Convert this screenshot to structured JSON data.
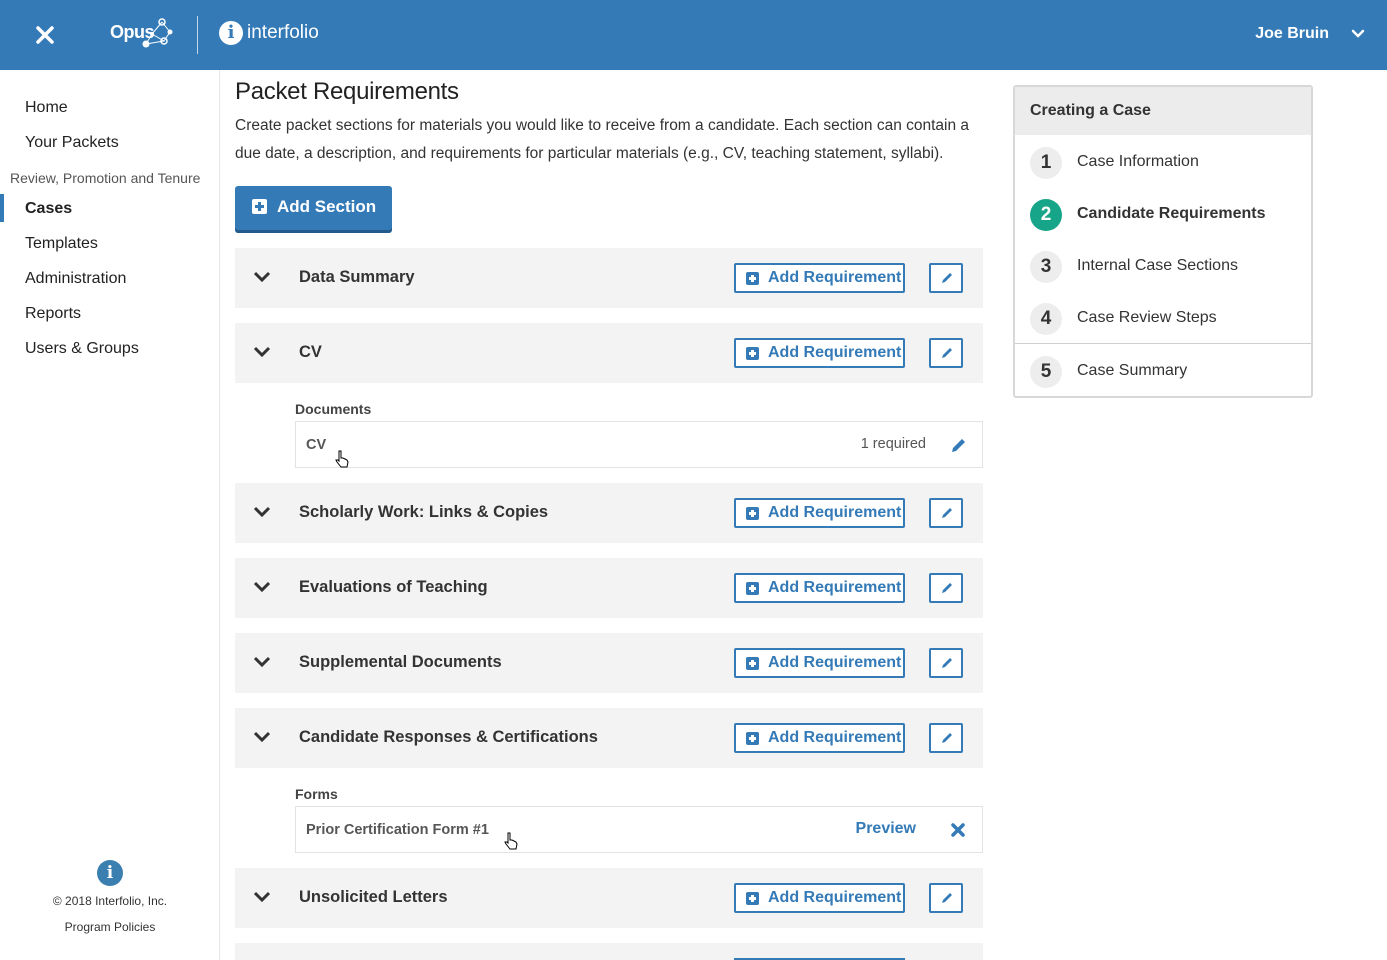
{
  "header": {
    "opus_label": "Opus",
    "interfolio_label": "interfolio",
    "user_name": "Joe Bruin"
  },
  "sidebar": {
    "items": [
      {
        "label": "Home"
      },
      {
        "label": "Your Packets"
      }
    ],
    "section_label": "Review, Promotion and Tenure",
    "section_items": [
      {
        "label": "Cases",
        "active": true
      },
      {
        "label": "Templates"
      },
      {
        "label": "Administration"
      },
      {
        "label": "Reports"
      },
      {
        "label": "Users & Groups"
      }
    ],
    "copyright": "© 2018 Interfolio, Inc.",
    "policies": "Program Policies"
  },
  "main": {
    "title": "Packet Requirements",
    "description": "Create packet sections for materials you would like to receive from a candidate. Each section can contain a due date, a description, and requirements for particular materials (e.g., CV, teaching statement, syllabi).",
    "add_section_label": "Add Section",
    "add_requirement_label": "Add Requirement",
    "sections": [
      {
        "title": "Data Summary"
      },
      {
        "title": "CV"
      },
      {
        "title": "Scholarly Work: Links & Copies"
      },
      {
        "title": "Evaluations of Teaching"
      },
      {
        "title": "Supplemental Documents"
      },
      {
        "title": "Candidate Responses & Certifications"
      },
      {
        "title": "Unsolicited Letters"
      }
    ],
    "cv_documents": {
      "label": "Documents",
      "item_name": "CV",
      "item_required": "1 required"
    },
    "cert_forms": {
      "label": "Forms",
      "item_name": "Prior Certification Form #1",
      "preview_label": "Preview"
    }
  },
  "panel": {
    "title": "Creating a Case",
    "steps": [
      {
        "number": "1",
        "label": "Case Information"
      },
      {
        "number": "2",
        "label": "Candidate Requirements",
        "active": true
      },
      {
        "number": "3",
        "label": "Internal Case Sections"
      },
      {
        "number": "4",
        "label": "Case Review Steps"
      },
      {
        "number": "5",
        "label": "Case Summary"
      }
    ]
  },
  "colors": {
    "brand": "#337ab7",
    "active_step": "#17a589",
    "section_bg": "#f3f3f3"
  }
}
